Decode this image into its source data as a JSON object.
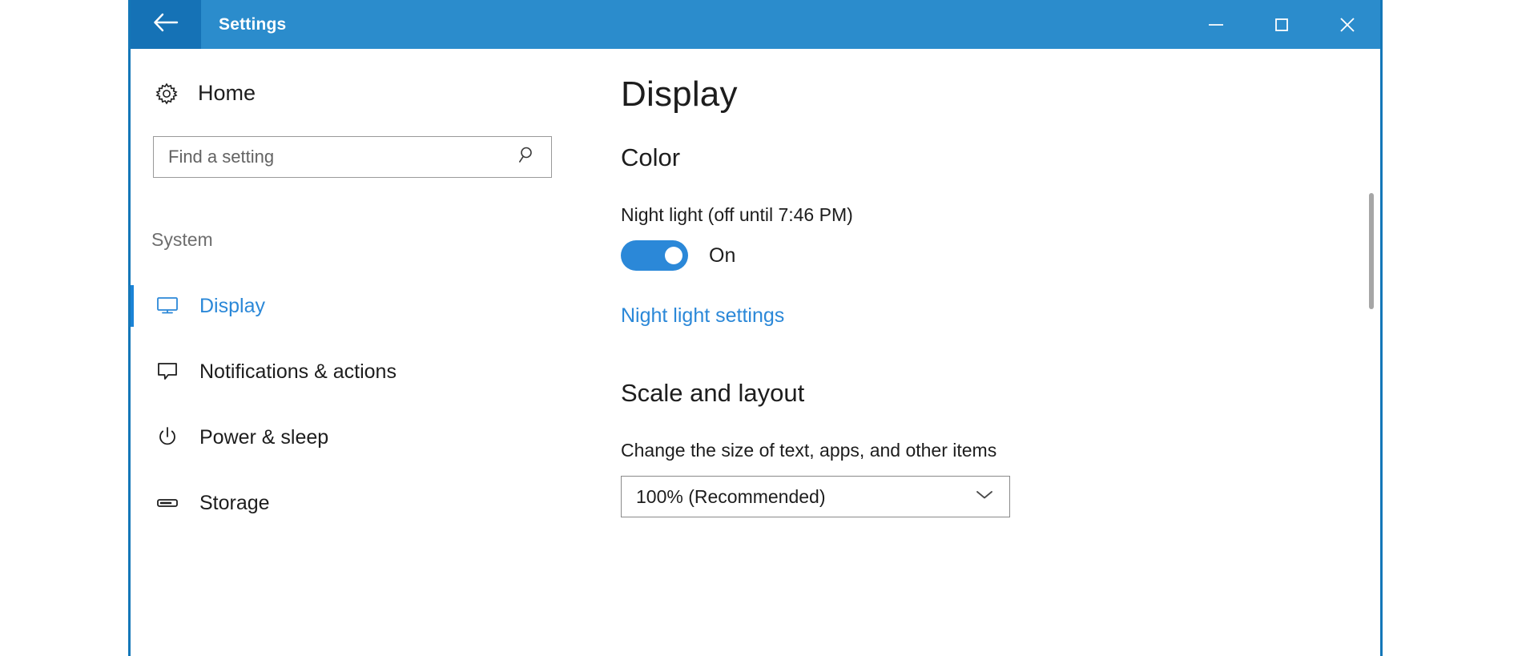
{
  "window": {
    "title": "Settings",
    "back_icon": "back-arrow-icon",
    "minimize_icon": "minimize-icon",
    "maximize_icon": "maximize-icon",
    "close_icon": "close-icon",
    "accent_color": "#2b88d8",
    "titlebar_color": "#2b8ccc",
    "back_button_color": "#1572b6",
    "border_color": "#1477b8"
  },
  "sidebar": {
    "home": {
      "label": "Home",
      "icon": "gear-icon"
    },
    "search": {
      "placeholder": "Find a setting",
      "value": "",
      "icon": "search-icon"
    },
    "group_header": "System",
    "items": [
      {
        "label": "Display",
        "icon": "monitor-icon",
        "selected": true
      },
      {
        "label": "Notifications & actions",
        "icon": "speech-bubble-icon",
        "selected": false
      },
      {
        "label": "Power & sleep",
        "icon": "power-icon",
        "selected": false
      },
      {
        "label": "Storage",
        "icon": "drive-icon",
        "selected": false
      }
    ]
  },
  "main": {
    "page_title": "Display",
    "color_section": {
      "heading": "Color",
      "night_light_label": "Night light (off until 7:46 PM)",
      "toggle_state": "On",
      "settings_link": "Night light settings"
    },
    "scale_section": {
      "heading": "Scale and layout",
      "size_label": "Change the size of text, apps, and other items",
      "scale_value": "100% (Recommended)",
      "chevron_icon": "chevron-down-icon"
    }
  }
}
